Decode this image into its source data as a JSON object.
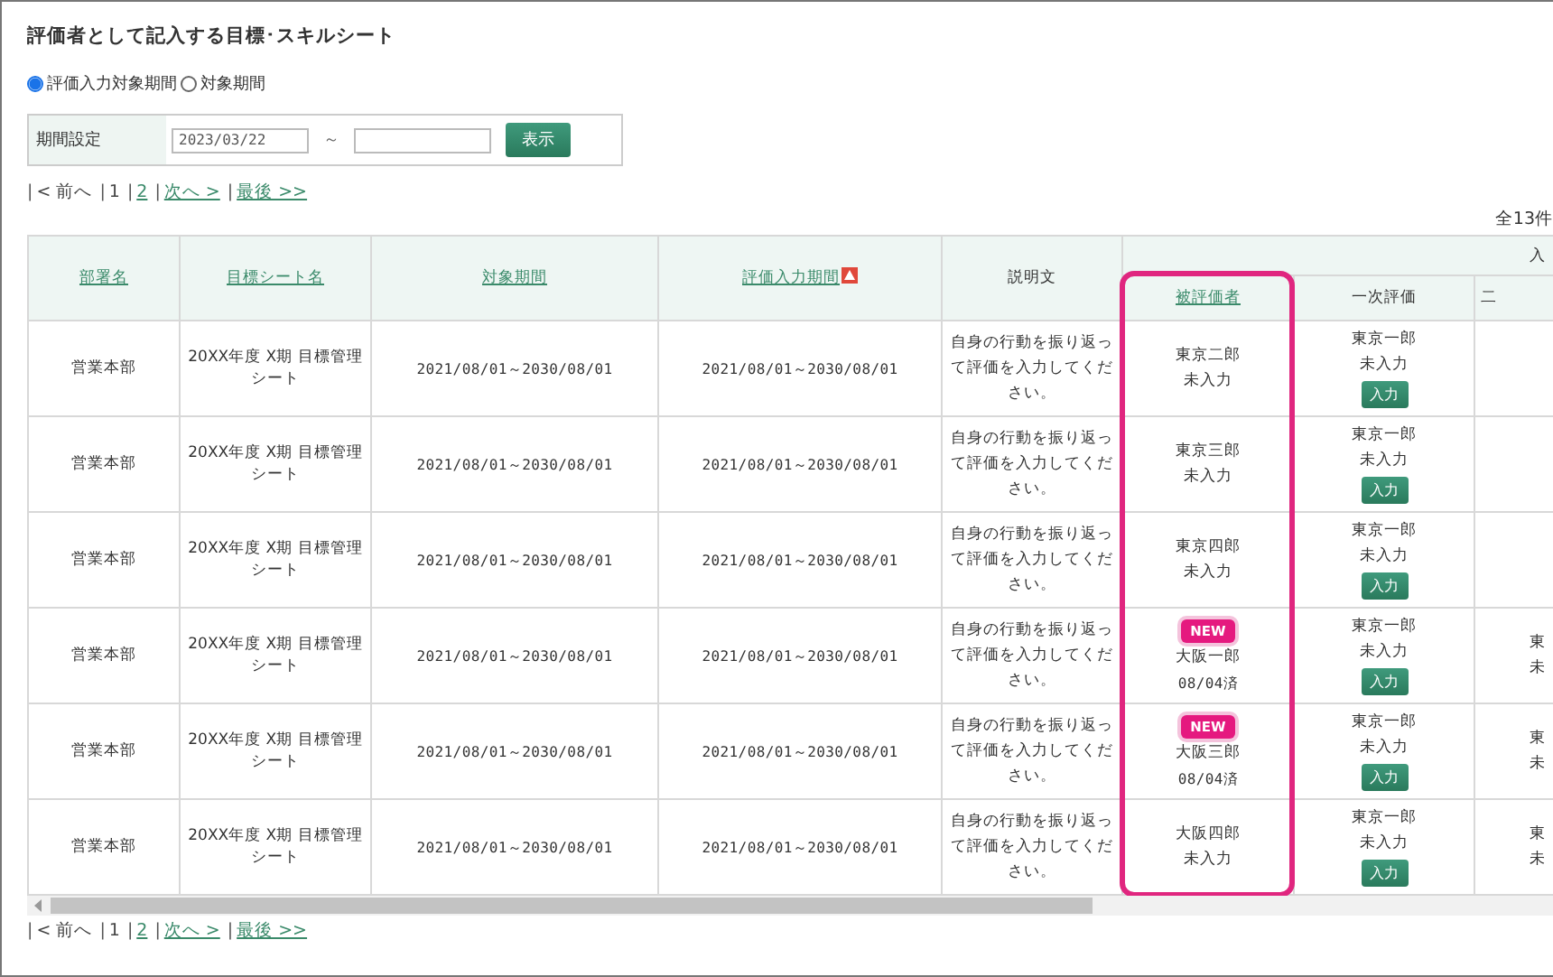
{
  "title": "評価者として記入する目標･スキルシート",
  "period_options": [
    {
      "label": "評価入力対象期間",
      "selected": true
    },
    {
      "label": "対象期間",
      "selected": false
    }
  ],
  "filter": {
    "label": "期間設定",
    "from_value": "2023/03/22",
    "separator": "～",
    "button": "表示"
  },
  "pager_top": {
    "separator": "|",
    "items": [
      {
        "label": "< 前へ",
        "kind": "disabled"
      },
      {
        "label": "1",
        "kind": "current"
      },
      {
        "label": "2",
        "kind": "link"
      },
      {
        "label": "次へ >",
        "kind": "link"
      },
      {
        "label": "最後 >>",
        "kind": "link"
      }
    ]
  },
  "total": "全13件",
  "table": {
    "columns": [
      {
        "label": "部署名",
        "kind": "link",
        "alert": false
      },
      {
        "label": "目標シート名",
        "kind": "link",
        "alert": false
      },
      {
        "label": "対象期間",
        "kind": "link",
        "alert": false
      },
      {
        "label": "評価入力期間",
        "kind": "link",
        "alert": true
      },
      {
        "label": "説明文",
        "kind": "plain",
        "alert": false
      }
    ],
    "group_header": "入",
    "sub_columns": [
      {
        "label": "被評価者",
        "kind": "link"
      },
      {
        "label": "一次評価",
        "kind": "plain"
      },
      {
        "label": "二",
        "kind": "plain"
      }
    ],
    "rows": [
      {
        "department": "営業本部",
        "sheet": "20XX年度 X期 目標管理シート",
        "period": "2021/08/01～2030/08/01",
        "input_period": "2021/08/01～2030/08/01",
        "description": "自身の行動を振り返って評価を入力してください。",
        "subject": {
          "new": false,
          "name": "東京二郎",
          "status": "未入力"
        },
        "first": {
          "name": "東京一郎",
          "status": "未入力",
          "button": "入力"
        },
        "column_8": {}
      },
      {
        "department": "営業本部",
        "sheet": "20XX年度 X期 目標管理シート",
        "period": "2021/08/01～2030/08/01",
        "input_period": "2021/08/01～2030/08/01",
        "description": "自身の行動を振り返って評価を入力してください。",
        "subject": {
          "new": false,
          "name": "東京三郎",
          "status": "未入力"
        },
        "first": {
          "name": "東京一郎",
          "status": "未入力",
          "button": "入力"
        },
        "column_8": {}
      },
      {
        "department": "営業本部",
        "sheet": "20XX年度 X期 目標管理シート",
        "period": "2021/08/01～2030/08/01",
        "input_period": "2021/08/01～2030/08/01",
        "description": "自身の行動を振り返って評価を入力してください。",
        "subject": {
          "new": false,
          "name": "東京四郎",
          "status": "未入力"
        },
        "first": {
          "name": "東京一郎",
          "status": "未入力",
          "button": "入力"
        },
        "column_8": {}
      },
      {
        "department": "営業本部",
        "sheet": "20XX年度 X期 目標管理シート",
        "period": "2021/08/01～2030/08/01",
        "input_period": "2021/08/01～2030/08/01",
        "description": "自身の行動を振り返って評価を入力してください。",
        "subject": {
          "new": true,
          "badge": "NEW",
          "name": "大阪一郎",
          "status": "08/04済"
        },
        "first": {
          "name": "東京一郎",
          "status": "未入力",
          "button": "入力"
        },
        "column_8": {
          "name": "東",
          "status": "未"
        }
      },
      {
        "department": "営業本部",
        "sheet": "20XX年度 X期 目標管理シート",
        "period": "2021/08/01～2030/08/01",
        "input_period": "2021/08/01～2030/08/01",
        "description": "自身の行動を振り返って評価を入力してください。",
        "subject": {
          "new": true,
          "badge": "NEW",
          "name": "大阪三郎",
          "status": "08/04済"
        },
        "first": {
          "name": "東京一郎",
          "status": "未入力",
          "button": "入力"
        },
        "column_8": {
          "name": "東",
          "status": "未"
        }
      },
      {
        "department": "営業本部",
        "sheet": "20XX年度 X期 目標管理シート",
        "period": "2021/08/01～2030/08/01",
        "input_period": "2021/08/01～2030/08/01",
        "description": "自身の行動を振り返って評価を入力してください。",
        "subject": {
          "new": false,
          "name": "大阪四郎",
          "status": "未入力"
        },
        "first": {
          "name": "東京一郎",
          "status": "未入力",
          "button": "入力"
        },
        "column_8": {
          "name": "東",
          "status": "未"
        }
      }
    ]
  },
  "pager_bottom": {
    "separator": "|",
    "items": [
      {
        "label": "< 前へ",
        "kind": "disabled"
      },
      {
        "label": "1",
        "kind": "current"
      },
      {
        "label": "2",
        "kind": "link"
      },
      {
        "label": "次へ >",
        "kind": "link"
      },
      {
        "label": "最後 >>",
        "kind": "link"
      }
    ]
  }
}
